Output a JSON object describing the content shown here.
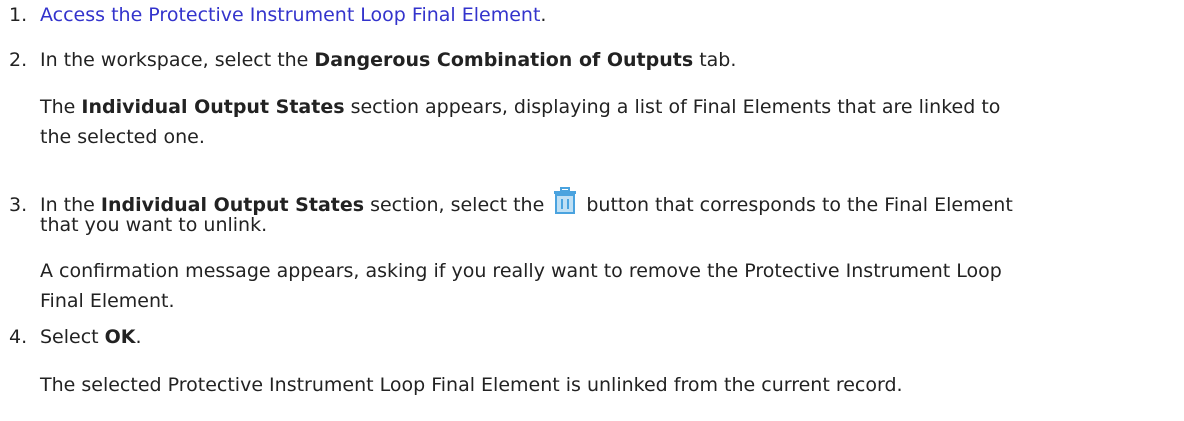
{
  "steps": [
    {
      "number": "1.",
      "link_text": "Access the Protective Instrument Loop Final Element",
      "after": "."
    },
    {
      "number": "2.",
      "before": "In the workspace, select the ",
      "bold": "Dangerous Combination of Outputs",
      "after": " tab.",
      "result_bold": "Individual Output States",
      "result_after_1": " section appears, displaying a list of Final Elements that are linked to",
      "result_line2": "the selected one.",
      "result_before": "The "
    },
    {
      "number": "3.",
      "before": "In the ",
      "bold": "Individual Output States",
      "middle": " section, select the ",
      "icon": "trash-icon",
      "after": " button that corresponds to the Final Element",
      "line2": "that you want to unlink.",
      "result_line1": "A confirmation message appears, asking if you really want to remove the Protective Instrument Loop",
      "result_line2": "Final Element."
    },
    {
      "number": "4.",
      "before": "Select ",
      "bold": "OK",
      "after": ".",
      "result": "The selected Protective Instrument Loop Final Element is unlinked from the current record."
    }
  ],
  "colors": {
    "link": "#3333cc",
    "text": "#222222",
    "icon": "#4aa3df"
  }
}
